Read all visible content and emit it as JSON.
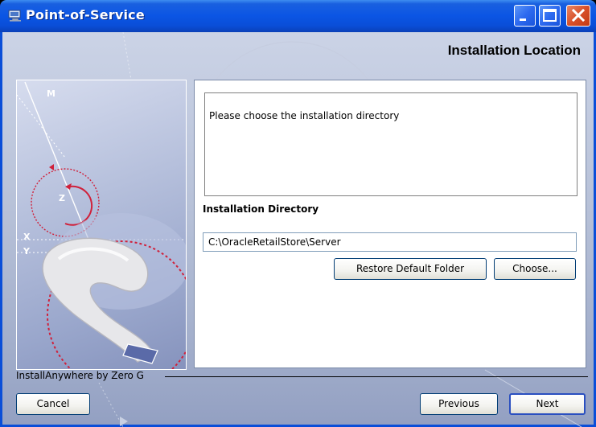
{
  "window": {
    "title": "Point-of-Service",
    "title_icon": "computer-icon",
    "controls": [
      "minimize-icon",
      "maximize-icon",
      "close-icon"
    ]
  },
  "step": {
    "title": "Installation Location"
  },
  "content": {
    "message": "Please choose the installation directory",
    "directory_label": "Installation Directory",
    "directory_value": "C:\\OracleRetailStore\\Server",
    "restore_label": "Restore Default Folder",
    "choose_label": "Choose..."
  },
  "side_image": {
    "letters": [
      "M",
      "Z",
      "X",
      "Y"
    ],
    "graphic": "wrench-icon"
  },
  "footer": {
    "vendor": "InstallAnywhere by Zero G",
    "cancel_label": "Cancel",
    "previous_label": "Previous",
    "next_label": "Next"
  },
  "colors": {
    "titlebar": "#0a4ed8",
    "close_button": "#d8502a",
    "accent_red": "#d0203a",
    "body_bg": "#b7c1d8"
  }
}
